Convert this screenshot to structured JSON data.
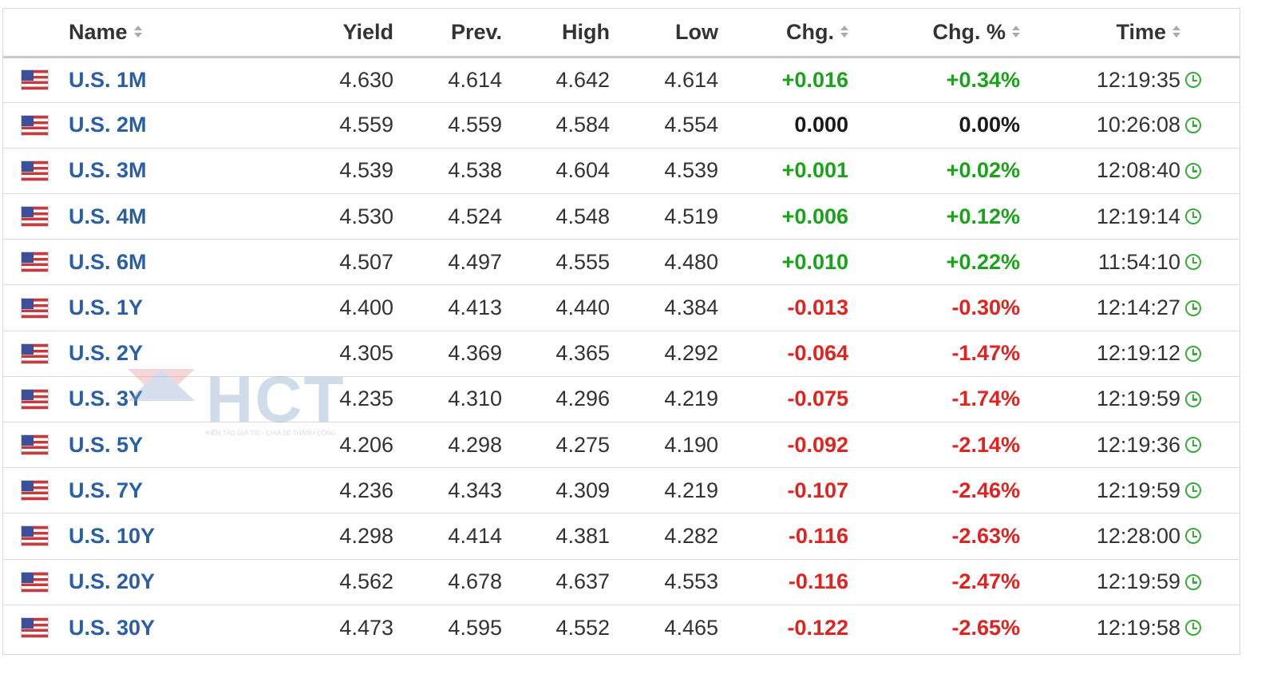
{
  "columns": {
    "name": "Name",
    "yield": "Yield",
    "prev": "Prev.",
    "high": "High",
    "low": "Low",
    "chg": "Chg.",
    "chg_pct": "Chg. %",
    "time": "Time"
  },
  "rows": [
    {
      "name": "U.S. 1M",
      "yield": "4.630",
      "prev": "4.614",
      "high": "4.642",
      "low": "4.614",
      "chg": "+0.016",
      "chg_pct": "+0.34%",
      "time": "12:19:35",
      "direction": "up"
    },
    {
      "name": "U.S. 2M",
      "yield": "4.559",
      "prev": "4.559",
      "high": "4.584",
      "low": "4.554",
      "chg": "0.000",
      "chg_pct": "0.00%",
      "time": "10:26:08",
      "direction": "flat"
    },
    {
      "name": "U.S. 3M",
      "yield": "4.539",
      "prev": "4.538",
      "high": "4.604",
      "low": "4.539",
      "chg": "+0.001",
      "chg_pct": "+0.02%",
      "time": "12:08:40",
      "direction": "up"
    },
    {
      "name": "U.S. 4M",
      "yield": "4.530",
      "prev": "4.524",
      "high": "4.548",
      "low": "4.519",
      "chg": "+0.006",
      "chg_pct": "+0.12%",
      "time": "12:19:14",
      "direction": "up"
    },
    {
      "name": "U.S. 6M",
      "yield": "4.507",
      "prev": "4.497",
      "high": "4.555",
      "low": "4.480",
      "chg": "+0.010",
      "chg_pct": "+0.22%",
      "time": "11:54:10",
      "direction": "up"
    },
    {
      "name": "U.S. 1Y",
      "yield": "4.400",
      "prev": "4.413",
      "high": "4.440",
      "low": "4.384",
      "chg": "-0.013",
      "chg_pct": "-0.30%",
      "time": "12:14:27",
      "direction": "down"
    },
    {
      "name": "U.S. 2Y",
      "yield": "4.305",
      "prev": "4.369",
      "high": "4.365",
      "low": "4.292",
      "chg": "-0.064",
      "chg_pct": "-1.47%",
      "time": "12:19:12",
      "direction": "down"
    },
    {
      "name": "U.S. 3Y",
      "yield": "4.235",
      "prev": "4.310",
      "high": "4.296",
      "low": "4.219",
      "chg": "-0.075",
      "chg_pct": "-1.74%",
      "time": "12:19:59",
      "direction": "down"
    },
    {
      "name": "U.S. 5Y",
      "yield": "4.206",
      "prev": "4.298",
      "high": "4.275",
      "low": "4.190",
      "chg": "-0.092",
      "chg_pct": "-2.14%",
      "time": "12:19:36",
      "direction": "down"
    },
    {
      "name": "U.S. 7Y",
      "yield": "4.236",
      "prev": "4.343",
      "high": "4.309",
      "low": "4.219",
      "chg": "-0.107",
      "chg_pct": "-2.46%",
      "time": "12:19:59",
      "direction": "down"
    },
    {
      "name": "U.S. 10Y",
      "yield": "4.298",
      "prev": "4.414",
      "high": "4.381",
      "low": "4.282",
      "chg": "-0.116",
      "chg_pct": "-2.63%",
      "time": "12:28:00",
      "direction": "down"
    },
    {
      "name": "U.S. 20Y",
      "yield": "4.562",
      "prev": "4.678",
      "high": "4.637",
      "low": "4.553",
      "chg": "-0.116",
      "chg_pct": "-2.47%",
      "time": "12:19:59",
      "direction": "down"
    },
    {
      "name": "U.S. 30Y",
      "yield": "4.473",
      "prev": "4.595",
      "high": "4.552",
      "low": "4.465",
      "chg": "-0.122",
      "chg_pct": "-2.65%",
      "time": "12:19:58",
      "direction": "down"
    }
  ],
  "icons": {
    "flag": "us-flag-icon",
    "clock": "clock-icon",
    "sort": "sort-arrows-icon"
  },
  "colors": {
    "positive": "#1aa31a",
    "negative": "#e0231e",
    "link": "#2a5fa3",
    "clock": "#3aaa3a"
  },
  "watermark": {
    "logo": "HCT",
    "tagline": "KIẾN TẠO GIÁ TRỊ - CHIA SẺ THÀNH CÔNG"
  }
}
